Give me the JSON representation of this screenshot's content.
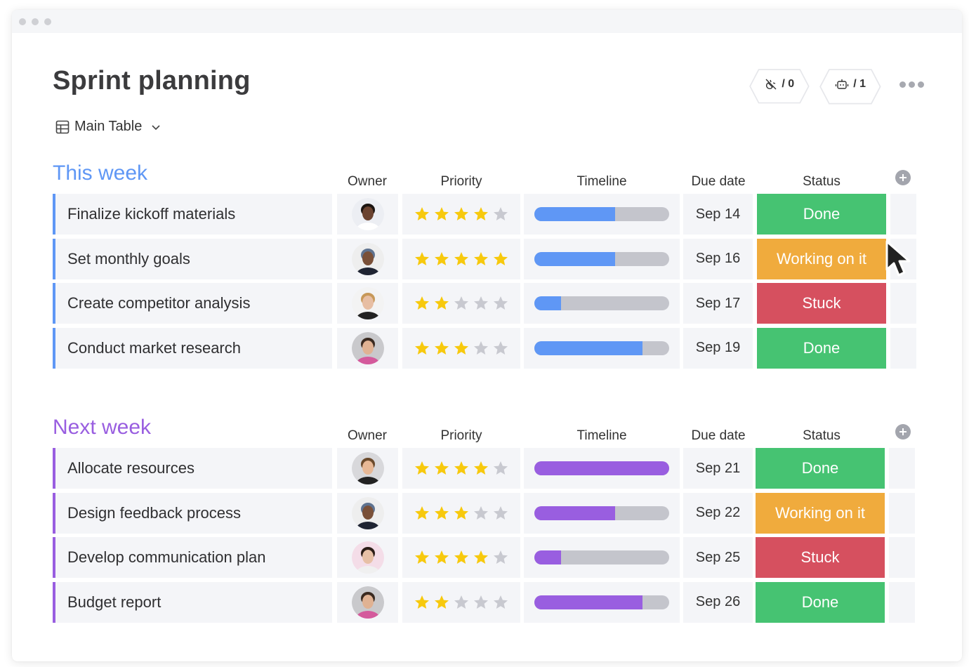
{
  "window": {
    "traffic_lights": 3
  },
  "board": {
    "title": "Sprint planning",
    "view": {
      "icon": "table-icon",
      "label": "Main Table",
      "dropdown_icon": "chevron-down-icon"
    }
  },
  "actions": {
    "integrations": {
      "icon": "plug-disconnected-icon",
      "label": "/ 0"
    },
    "automations": {
      "icon": "robot-icon",
      "label": "/ 1"
    },
    "more": {
      "icon": "more-dots-icon"
    }
  },
  "columns": [
    "Owner",
    "Priority",
    "Timeline",
    "Due date",
    "Status"
  ],
  "status_colors": {
    "Done": "#46c372",
    "Working on it": "#f0ab3d",
    "Stuck": "#d6505f"
  },
  "groups": [
    {
      "title": "This week",
      "color": "#5f97f5",
      "rows": [
        {
          "name": "Finalize kickoff materials",
          "owner": "woman-curly-hair-glasses",
          "priority": 4,
          "timeline_progress": 0.6,
          "due": "Sep 14",
          "status": "Done"
        },
        {
          "name": "Set monthly goals",
          "owner": "man-cap-beard",
          "priority": 5,
          "timeline_progress": 0.6,
          "due": "Sep 16",
          "status": "Working on it"
        },
        {
          "name": "Create competitor analysis",
          "owner": "woman-blonde-hair",
          "priority": 2,
          "timeline_progress": 0.2,
          "due": "Sep 17",
          "status": "Stuck"
        },
        {
          "name": "Conduct market research",
          "owner": "man-beard-floral-shirt",
          "priority": 3,
          "timeline_progress": 0.8,
          "due": "Sep 19",
          "status": "Done"
        }
      ]
    },
    {
      "title": "Next week",
      "color": "#995ee0",
      "rows": [
        {
          "name": "Allocate resources",
          "owner": "man-short-hair-smiling",
          "priority": 4,
          "timeline_progress": 1.0,
          "due": "Sep 21",
          "status": "Done"
        },
        {
          "name": "Design feedback process",
          "owner": "man-cap-beard",
          "priority": 3,
          "timeline_progress": 0.6,
          "due": "Sep 22",
          "status": "Working on it"
        },
        {
          "name": "Develop communication plan",
          "owner": "woman-dark-hair",
          "priority": 4,
          "timeline_progress": 0.2,
          "due": "Sep 25",
          "status": "Stuck"
        },
        {
          "name": "Budget report",
          "owner": "man-beard-floral-shirt",
          "priority": 2,
          "timeline_progress": 0.8,
          "due": "Sep 26",
          "status": "Done"
        }
      ]
    }
  ],
  "ui_colors": {
    "star_on": "#f7c90d",
    "star_off": "#c8c9d0",
    "bar_track": "#c4c5cc"
  }
}
